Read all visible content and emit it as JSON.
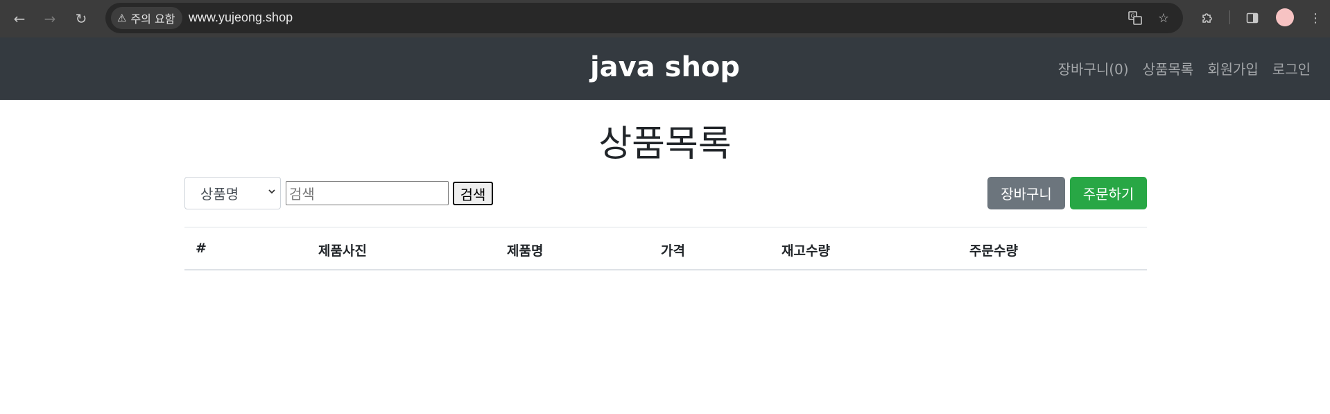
{
  "browser": {
    "back_icon": "arrow-left-icon",
    "forward_icon": "arrow-right-icon",
    "reload_icon": "reload-icon",
    "security_label": "주의 요함",
    "url": "www.yujeong.shop",
    "translate_icon": "translate-icon",
    "bookmark_icon": "star-icon",
    "extensions_icon": "puzzle-icon",
    "sidepanel_icon": "side-panel-icon",
    "menu_icon": "kebab-menu-icon"
  },
  "navbar": {
    "brand": "java shop",
    "links": [
      {
        "label": "장바구니(0)"
      },
      {
        "label": "상품목록"
      },
      {
        "label": "회원가입"
      },
      {
        "label": "로그인"
      }
    ]
  },
  "main": {
    "title": "상품목록",
    "search": {
      "select_value": "상품명",
      "placeholder": "검색",
      "button_label": "검색"
    },
    "cart_button": "장바구니",
    "order_button": "주문하기",
    "table": {
      "headers": [
        "#",
        "제품사진",
        "제품명",
        "가격",
        "재고수량",
        "주문수량"
      ],
      "rows": []
    }
  },
  "colors": {
    "navbar_bg": "#343a40",
    "cart_button_bg": "#6c757d",
    "order_button_bg": "#28a745"
  }
}
